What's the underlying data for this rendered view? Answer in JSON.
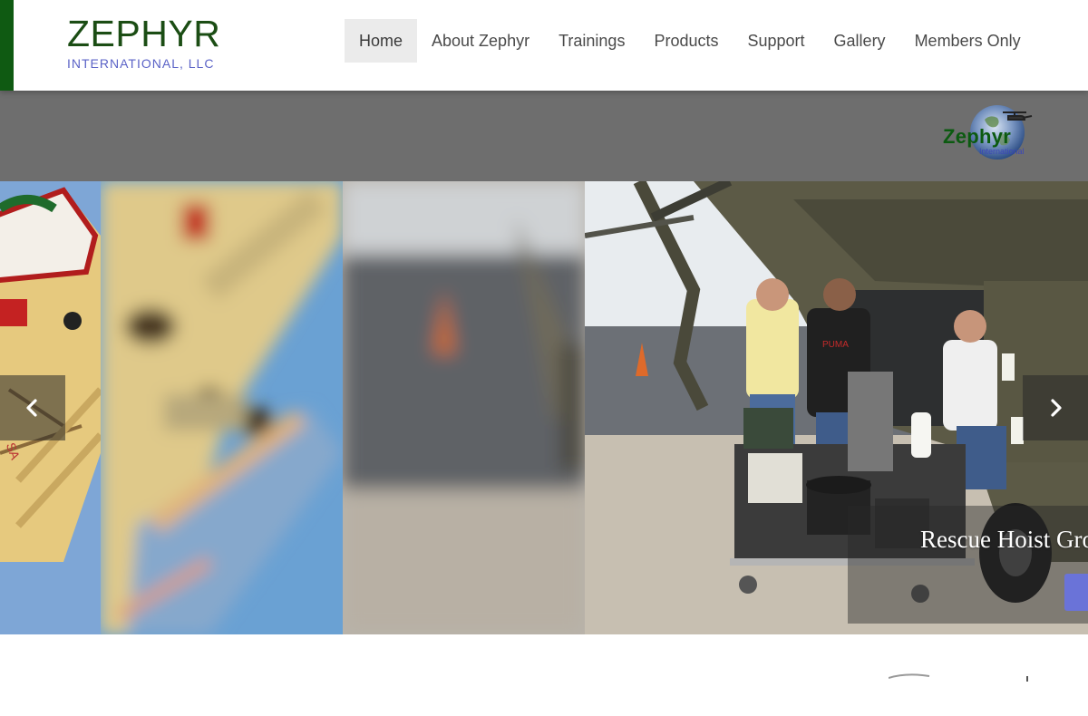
{
  "brand": {
    "title": "ZEPHYR",
    "subtitle": "INTERNATIONAL, LLC"
  },
  "nav": {
    "items": [
      {
        "label": "Home",
        "active": true
      },
      {
        "label": "About Zephyr",
        "active": false
      },
      {
        "label": "Trainings",
        "active": false
      },
      {
        "label": "Products",
        "active": false
      },
      {
        "label": "Support",
        "active": false
      },
      {
        "label": "Gallery",
        "active": false
      },
      {
        "label": "Members Only",
        "active": false
      }
    ]
  },
  "band_logo": {
    "text": "Zephyr",
    "subtext": "International"
  },
  "carousel": {
    "caption": "Rescue Hoist Gro",
    "prev_icon": "chevron-left-icon",
    "next_icon": "chevron-right-icon"
  },
  "colors": {
    "brand_green": "#1b4d14",
    "brand_blue": "#5b63c7",
    "band_grey": "#6e6e6e",
    "button_blue": "#6a73d8"
  }
}
